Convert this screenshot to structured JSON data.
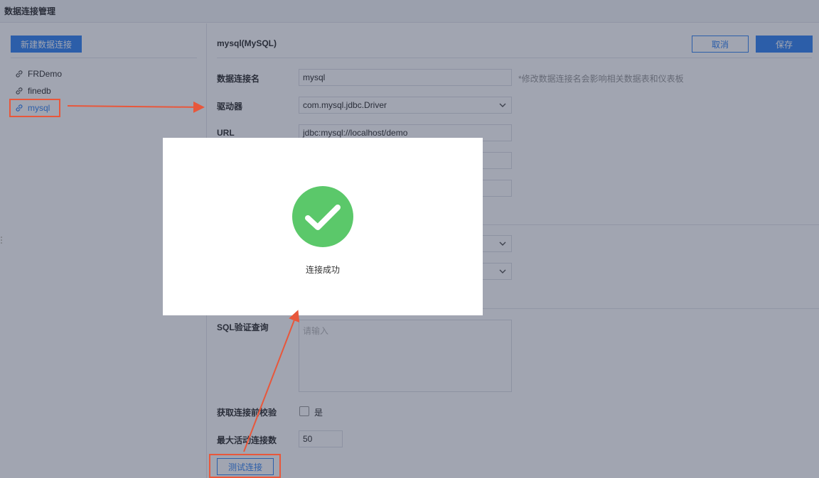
{
  "topbar": {
    "title": "数据连接管理"
  },
  "sidebar": {
    "new_button": "新建数据连接",
    "items": [
      {
        "label": "FRDemo",
        "icon": "link-icon"
      },
      {
        "label": "finedb",
        "icon": "link-icon"
      },
      {
        "label": "mysql",
        "icon": "link-icon",
        "selected": true
      }
    ]
  },
  "main": {
    "title": "mysql(MySQL)",
    "cancel_label": "取消",
    "save_label": "保存",
    "fields": {
      "name_label": "数据连接名",
      "name_value": "mysql",
      "name_hint": "*修改数据连接名会影响相关数据表和仪表板",
      "driver_label": "驱动器",
      "driver_value": "com.mysql.jdbc.Driver",
      "url_label": "URL",
      "url_value": "jdbc:mysql://localhost/demo",
      "sql_label": "SQL验证查询",
      "sql_placeholder": "请输入",
      "validate_label": "获取连接前校验",
      "validate_option": "是",
      "max_active_label": "最大活动连接数",
      "max_active_value": "50"
    },
    "test_button": "测试连接"
  },
  "modal": {
    "message": "连接成功",
    "icon": "check-circle-icon"
  },
  "colors": {
    "primary": "#3685f2",
    "success": "#5bc86a",
    "annotation": "#e8573b"
  }
}
